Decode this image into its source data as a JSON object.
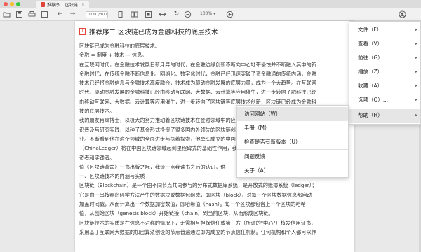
{
  "window": {
    "tab_title": "推荐序二 区块链",
    "tab_close": "×"
  },
  "toolbar": {
    "page_indicator": "1/31 /300",
    "zoom_level": "100% ▾",
    "icons": [
      "folder-icon",
      "save-icon",
      "print-icon",
      "sidebar-icon",
      "back-icon",
      "forward-icon",
      "single-page-icon",
      "dual-page-icon",
      "fit-page-icon",
      "fit-width-icon",
      "rotate-icon",
      "zoom-out-icon",
      "zoom-in-icon",
      "user-icon"
    ]
  },
  "document": {
    "title": "推荐序二 区块链已成为金融科技的底层技术",
    "title_icon": "T",
    "lines": [
      "区块链已成为金融科技的底层技术。",
      "金融 = 制度 + 技术 + 信息。",
      "在互联网时代，在金融技术发展日新月异的时代，在金融边缘创新不断向中心地带侵蚀并不断融入其中的新",
      "金融时代，在传统金融不断信息化、网络化、数字化时代，金融已经迅速突破了资金融通的传统内涵，金融",
      "技术已经将金融信息与金融技术高度融合，技术成为驱动金融发展的底层力量，成为一个大趋势。在互联网",
      "时代，驱动金融发展的金融科技已经由移动互联网、大数据、云计算等应用催生，进一步转向了融科技已经",
      "由移动互联网、大数据、云计算等应用催生，进一步转向了区块链等底层技术创新，区块链已经成为金融科",
      "技的底层技术。",
      "我的朋友肖风博士，以极大的努力推动着区块链技术在金融领域中的应用，这是首",
      "识普及与研究实践，以种子基金形式投资了很多国内外领先的区块链创业",
      "业。不断看到他在这个领域的全面进步与执着探索，他牵头成立的中国",
      "（ChinaLedger）将在中国区块链领域起到里程碑式的基础性作用，我也",
      "资者和实践者。",
      "值《区块链革命》一书出版之际，我谈一点我读书之后的认识，供",
      "一、区块链技术的内涵与实质",
      "区块链（Blockchain）是一个由不同节点共同参与的分布式数据库系统，是开放式的账簿系统（ledger）；",
      "它是由一串按照密码学方法产生的数据块或数据包组成，即区块（block），对每一个区块数据信息都自动",
      "加盖时间戳，从而计算出一个数据加密数值，即哈希值（hash）。每一个区块都包含上一个区块的哈希",
      "值，从创始区块（genesis block）开始链接（chain）到当前区块，从而形成区块链。",
      "区块链技术的实质是在信息不对称的情况下，无需相互担保信任或第三方（所谓的\"中心\"）核发信用证书，",
      "采用基于互联网大数据的加密算法创设的节点普遍通过即为成立的节点信任机制。任何机构和个人都可以作"
    ]
  },
  "main_menu": {
    "items": [
      {
        "label": "文件（F）",
        "arrow": "▸"
      },
      {
        "label": "查看（V）",
        "arrow": "▸"
      },
      {
        "label": "前往（G）",
        "arrow": "▸"
      },
      {
        "label": "缩放（Z）",
        "arrow": "▸"
      },
      {
        "label": "收藏（A）",
        "arrow": "▸"
      },
      {
        "label": "选项（O）...",
        "arrow": "▸"
      },
      {
        "label": "帮助（H）",
        "arrow": "▸"
      }
    ],
    "active_index": 6
  },
  "help_menu": {
    "items": [
      {
        "label": "访问网站（W）"
      },
      {
        "label": "手册（M）"
      },
      {
        "label": "检查是否有新版本（U）"
      },
      {
        "label": "问题反馈"
      },
      {
        "label": "关于（A）..."
      }
    ],
    "active_index": 0
  },
  "colors": {
    "accent_pdf": "#e0443a",
    "menu_highlight": "#e6e6e6"
  }
}
